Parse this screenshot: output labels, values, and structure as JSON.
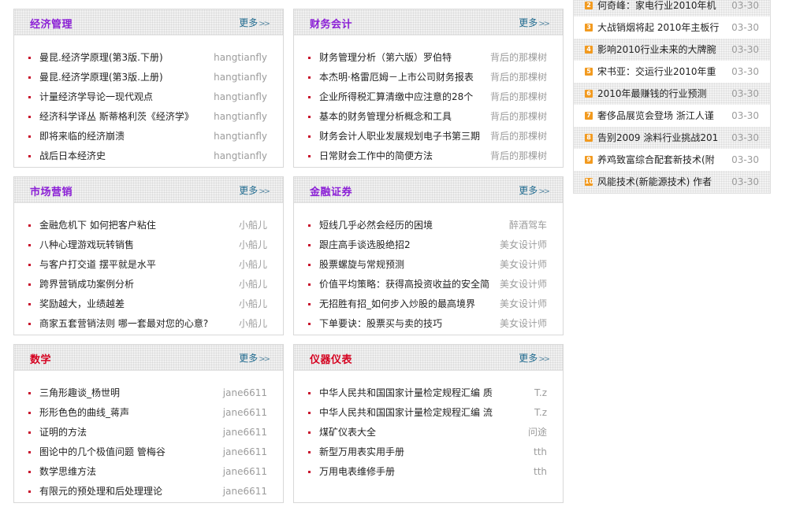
{
  "colors": {
    "title_purple": "#8b1fd6",
    "title_red": "#d5001f",
    "more_link": "#1f6a8f",
    "bullet": "#c8112b",
    "rank_badge": "#f29a1f"
  },
  "panels": [
    {
      "title": "经济管理",
      "title_color": "#8b1fd6",
      "more": "更多",
      "items": [
        {
          "title": "曼昆.经济学原理(第3版.下册)",
          "author": "hangtianfly"
        },
        {
          "title": "曼昆.经济学原理(第3版.上册)",
          "author": "hangtianfly"
        },
        {
          "title": "计量经济学导论一现代观点",
          "author": "hangtianfly"
        },
        {
          "title": "经济科学译丛 斯蒂格利茨《经济学》",
          "author": "hangtianfly"
        },
        {
          "title": "即将来临的经济崩溃",
          "author": "hangtianfly"
        },
        {
          "title": "战后日本经济史",
          "author": "hangtianfly"
        }
      ]
    },
    {
      "title": "财务会计",
      "title_color": "#8b1fd6",
      "more": "更多",
      "items": [
        {
          "title": "财务管理分析（第六版）罗伯特",
          "author": "背后的那棵树"
        },
        {
          "title": "本杰明·格雷厄姆－上市公司财务报表",
          "author": "背后的那棵树"
        },
        {
          "title": "企业所得税汇算清缴中应注意的28个",
          "author": "背后的那棵树"
        },
        {
          "title": "基本的财务管理分析概念和工具",
          "author": "背后的那棵树"
        },
        {
          "title": "财务会计人职业发展规划电子书第三期",
          "author": "背后的那棵树"
        },
        {
          "title": "日常财会工作中的简便方法",
          "author": "背后的那棵树"
        }
      ]
    },
    {
      "title": "市场营销",
      "title_color": "#8b1fd6",
      "more": "更多",
      "items": [
        {
          "title": "金融危机下 如何把客户粘住",
          "author": "小船儿"
        },
        {
          "title": "八种心理游戏玩转销售",
          "author": "小船儿"
        },
        {
          "title": "与客户打交道 摆平就是水平",
          "author": "小船儿"
        },
        {
          "title": "跨界营销成功案例分析",
          "author": "小船儿"
        },
        {
          "title": "奖励越大，业绩越差",
          "author": "小船儿"
        },
        {
          "title": "商家五套营销法则 哪一套最对您的心意?",
          "author": "小船儿"
        }
      ]
    },
    {
      "title": "金融证券",
      "title_color": "#8b1fd6",
      "more": "更多",
      "items": [
        {
          "title": "短线几乎必然会经历的困境",
          "author": "醉酒驾车"
        },
        {
          "title": "跟庄高手谈选股绝招2",
          "author": "美女设计师"
        },
        {
          "title": "股票螺旋与常规预测",
          "author": "美女设计师"
        },
        {
          "title": "价值平均策略：获得高投资收益的安全简",
          "author": "美女设计师"
        },
        {
          "title": "无招胜有招_如何步入炒股的最高境界",
          "author": "美女设计师"
        },
        {
          "title": "下单要诀：股票买与卖的技巧",
          "author": "美女设计师"
        }
      ]
    },
    {
      "title": "数学",
      "title_color": "#d5001f",
      "more": "更多",
      "items": [
        {
          "title": "三角形趣谈_杨世明",
          "author": "jane6611"
        },
        {
          "title": "形形色色的曲线_蒋声",
          "author": "jane6611"
        },
        {
          "title": "证明的方法",
          "author": "jane6611"
        },
        {
          "title": "图论中的几个极值问题 管梅谷",
          "author": "jane6611"
        },
        {
          "title": "数学思维方法",
          "author": "jane6611"
        },
        {
          "title": "有限元的预处理和后处理理论",
          "author": "jane6611"
        }
      ]
    },
    {
      "title": "仪器仪表",
      "title_color": "#d5001f",
      "more": "更多",
      "items": [
        {
          "title": "中华人民共和国国家计量检定规程汇编 质",
          "author": "T.z"
        },
        {
          "title": "中华人民共和国国家计量检定规程汇编 流",
          "author": "T.z"
        },
        {
          "title": "煤矿仪表大全",
          "author": "问途"
        },
        {
          "title": "新型万用表实用手册",
          "author": "tth"
        },
        {
          "title": "万用电表维修手册",
          "author": "tth"
        }
      ]
    }
  ],
  "ranking": [
    {
      "num": "2",
      "title": "何奇峰：家电行业2010年机",
      "date": "03-30"
    },
    {
      "num": "3",
      "title": "大战销烟将起 2010年主板行",
      "date": "03-30"
    },
    {
      "num": "4",
      "title": "影响2010行业未来的大牌腕",
      "date": "03-30"
    },
    {
      "num": "5",
      "title": "宋书亚：交运行业2010年重",
      "date": "03-30"
    },
    {
      "num": "6",
      "title": "2010年最赚钱的行业预测",
      "date": "03-30"
    },
    {
      "num": "7",
      "title": "奢侈品展览会登场 浙江人谨",
      "date": "03-30"
    },
    {
      "num": "8",
      "title": "告别2009 涂料行业挑战201",
      "date": "03-30"
    },
    {
      "num": "9",
      "title": "养鸡致富综合配套新技术(附",
      "date": "03-30"
    },
    {
      "num": "10",
      "title": "风能技术(新能源技术) 作者",
      "date": "03-30"
    }
  ]
}
